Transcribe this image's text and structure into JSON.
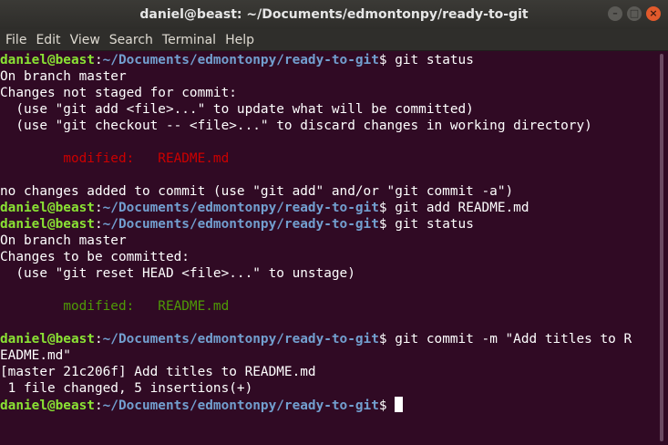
{
  "window": {
    "title": "daniel@beast: ~/Documents/edmontonpy/ready-to-git",
    "buttons": {
      "minimize": "–",
      "maximize": "□",
      "close": "×"
    }
  },
  "menu": [
    "File",
    "Edit",
    "View",
    "Search",
    "Terminal",
    "Help"
  ],
  "prompt": {
    "user": "daniel@beast",
    "sep": ":",
    "path": "~/Documents/edmontonpy/ready-to-git",
    "sym": "$"
  },
  "lines": [
    {
      "type": "prompt",
      "cmd": " git status"
    },
    {
      "type": "plain",
      "text": "On branch master"
    },
    {
      "type": "plain",
      "text": "Changes not staged for commit:"
    },
    {
      "type": "plain",
      "text": "  (use \"git add <file>...\" to update what will be committed)"
    },
    {
      "type": "plain",
      "text": "  (use \"git checkout -- <file>...\" to discard changes in working directory)"
    },
    {
      "type": "plain",
      "text": ""
    },
    {
      "type": "red",
      "text": "\tmodified:   README.md"
    },
    {
      "type": "plain",
      "text": ""
    },
    {
      "type": "plain",
      "text": "no changes added to commit (use \"git add\" and/or \"git commit -a\")"
    },
    {
      "type": "prompt",
      "cmd": " git add README.md"
    },
    {
      "type": "prompt",
      "cmd": " git status"
    },
    {
      "type": "plain",
      "text": "On branch master"
    },
    {
      "type": "plain",
      "text": "Changes to be committed:"
    },
    {
      "type": "plain",
      "text": "  (use \"git reset HEAD <file>...\" to unstage)"
    },
    {
      "type": "plain",
      "text": ""
    },
    {
      "type": "green",
      "text": "\tmodified:   README.md"
    },
    {
      "type": "plain",
      "text": ""
    },
    {
      "type": "prompt",
      "cmd": " git commit -m \"Add titles to R"
    },
    {
      "type": "plain",
      "text": "EADME.md\""
    },
    {
      "type": "plain",
      "text": "[master 21c206f] Add titles to README.md"
    },
    {
      "type": "plain",
      "text": " 1 file changed, 5 insertions(+)"
    },
    {
      "type": "prompt",
      "cmd": " ",
      "cursor": true
    }
  ]
}
